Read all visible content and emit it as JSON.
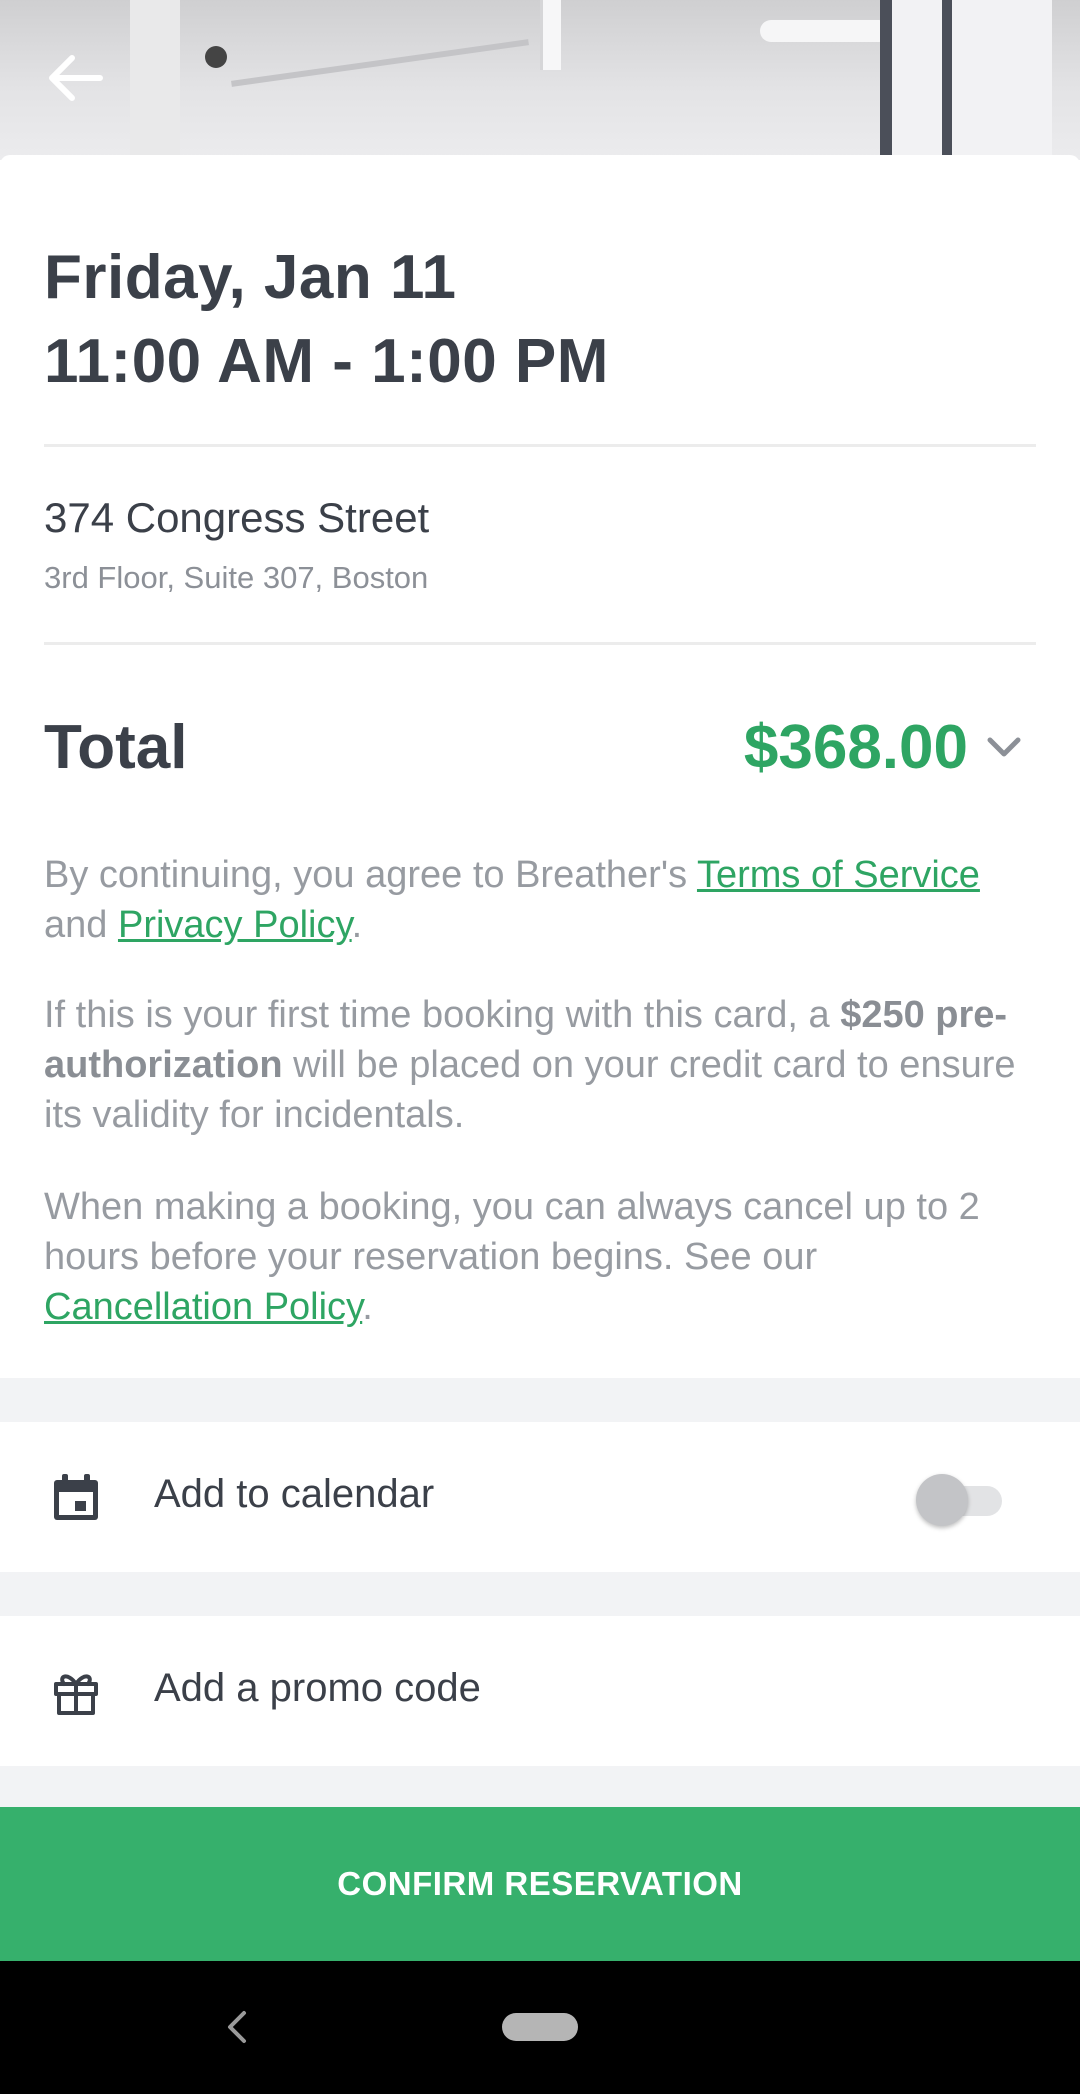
{
  "colors": {
    "accent": "#2ea563",
    "confirm_bg": "#36b06c",
    "text_dark": "#3b4049",
    "text_muted": "#979ba1"
  },
  "header": {
    "back_icon": "arrow-left-icon"
  },
  "booking": {
    "date": "Friday, Jan 11",
    "time_range": "11:00 AM - 1:00 PM",
    "address_line1": "374 Congress Street",
    "address_line2": "3rd Floor, Suite 307, Boston"
  },
  "total": {
    "label": "Total",
    "amount": "$368.00",
    "expand_icon": "chevron-down-icon"
  },
  "legal": {
    "p1_prefix": "By continuing, you agree to Breather's ",
    "terms_link": "Terms of Service",
    "p1_and": "and ",
    "privacy_link": "Privacy Policy",
    "p1_suffix": ".",
    "p2_prefix": "If this is your first time booking with this card, a ",
    "p2_bold": "$250 pre-authorization",
    "p2_suffix": " will be placed on your credit card to ensure its validity for incidentals.",
    "p3_prefix": "When making a booking, you can always cancel up to 2 hours before your reservation begins. See our ",
    "cancellation_link": "Cancellation Policy",
    "p3_suffix": "."
  },
  "options": {
    "calendar_label": "Add to calendar",
    "calendar_icon": "calendar-icon",
    "calendar_enabled": false,
    "promo_label": "Add a promo code",
    "promo_icon": "gift-icon"
  },
  "actions": {
    "confirm_label": "CONFIRM RESERVATION"
  },
  "system_nav": {
    "back_icon": "nav-back-icon",
    "home_icon": "nav-home-pill"
  }
}
